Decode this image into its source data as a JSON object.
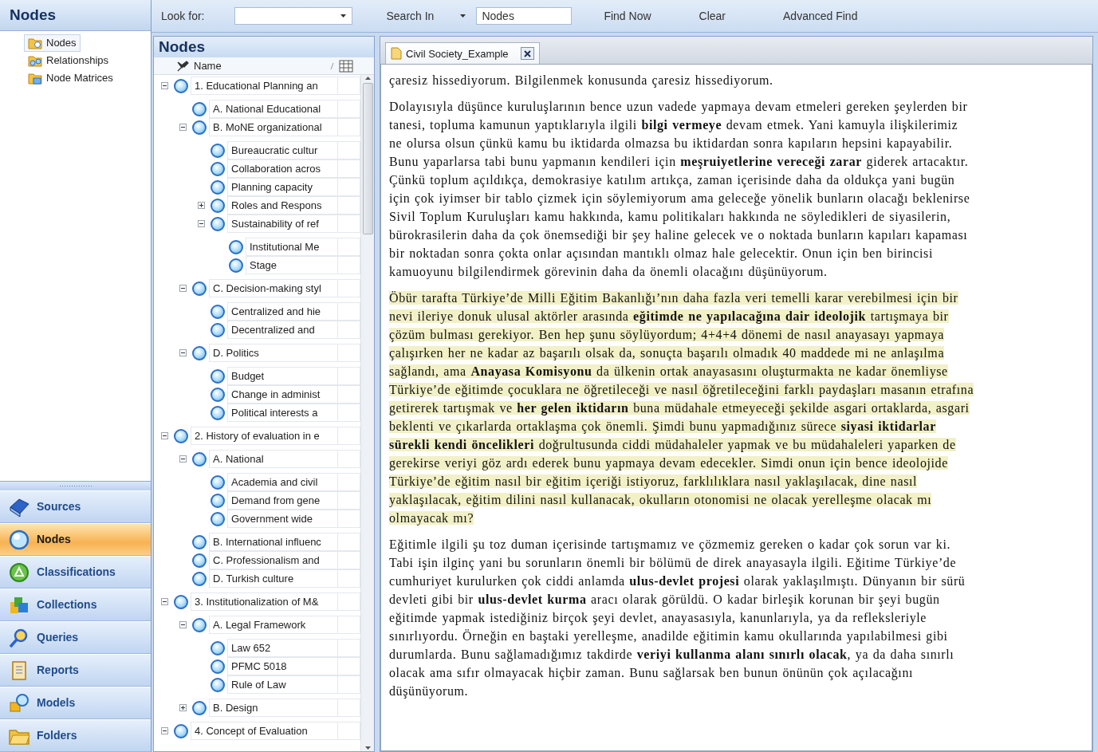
{
  "sidebar": {
    "title": "Nodes",
    "items": [
      {
        "label": "Nodes",
        "selected": true
      },
      {
        "label": "Relationships",
        "selected": false
      },
      {
        "label": "Node Matrices",
        "selected": false
      }
    ],
    "nav": [
      {
        "label": "Sources",
        "selected": false
      },
      {
        "label": "Nodes",
        "selected": true
      },
      {
        "label": "Classifications",
        "selected": false
      },
      {
        "label": "Collections",
        "selected": false
      },
      {
        "label": "Queries",
        "selected": false
      },
      {
        "label": "Reports",
        "selected": false
      },
      {
        "label": "Models",
        "selected": false
      },
      {
        "label": "Folders",
        "selected": false
      }
    ]
  },
  "find_bar": {
    "look_for_label": "Look for:",
    "search_in": "Search In",
    "scope": "Nodes",
    "buttons": [
      "Find Now",
      "Clear",
      "Advanced Find"
    ]
  },
  "nodes_panel": {
    "title": "Nodes",
    "column": "Name",
    "tree": [
      {
        "label": "1. Educational Planning an",
        "expanded": true,
        "children": [
          {
            "label": "A. National Educational"
          },
          {
            "label": "B. MoNE organizational",
            "expanded": true,
            "children": [
              {
                "label": "Bureaucratic cultur"
              },
              {
                "label": "Collaboration acros"
              },
              {
                "label": "Planning capacity"
              },
              {
                "label": "Roles and Respons",
                "expanded": false
              },
              {
                "label": "Sustainability of ref",
                "expanded": true,
                "children": [
                  {
                    "label": "Institutional Me"
                  },
                  {
                    "label": "Stage"
                  }
                ]
              }
            ]
          },
          {
            "label": "C. Decision-making styl",
            "expanded": true,
            "children": [
              {
                "label": "Centralized and hie"
              },
              {
                "label": "Decentralized and"
              }
            ]
          },
          {
            "label": "D. Politics",
            "expanded": true,
            "children": [
              {
                "label": "Budget"
              },
              {
                "label": "Change in administ"
              },
              {
                "label": "Political interests a"
              }
            ]
          }
        ]
      },
      {
        "label": "2. History of evaluation in e",
        "expanded": true,
        "children": [
          {
            "label": "A. National",
            "expanded": true,
            "children": [
              {
                "label": "Academia and civil"
              },
              {
                "label": "Demand from gene"
              },
              {
                "label": "Government wide"
              }
            ]
          },
          {
            "label": "B. International influenc"
          },
          {
            "label": "C. Professionalism and"
          },
          {
            "label": "D. Turkish culture"
          }
        ]
      },
      {
        "label": "3. Institutionalization of M&",
        "expanded": true,
        "children": [
          {
            "label": "A. Legal Framework",
            "expanded": true,
            "children": [
              {
                "label": "Law 652"
              },
              {
                "label": "PFMC 5018"
              },
              {
                "label": "Rule of Law"
              }
            ]
          },
          {
            "label": "B. Design",
            "expanded": false
          }
        ]
      },
      {
        "label": "4. Concept of Evaluation",
        "expanded": true
      }
    ]
  },
  "document": {
    "tabs": [
      {
        "label": "Civil Society_Example",
        "selected": true
      }
    ],
    "paragraphs": [
      {
        "text": "çaresiz hissediyorum. Bilgilenmek konusunda çaresiz hissediyorum.",
        "highlighted": false
      },
      {
        "text": "Dolayısıyla düşünce kuruluşlarının bence uzun vadede yapmaya devam etmeleri gereken şeylerden bir tanesi, topluma kamunun yaptıklarıyla ilgili **bilgi vermeye** devam etmek. Yani kamuyla ilişkilerimiz ne olursa olsun çünkü kamu bu iktidarda olmazsa bu iktidardan sonra kapıların hepsini kapayabilir. Bunu yaparlarsa tabi bunu yapmanın kendileri için **meşruiyetlerine vereceği zarar** giderek artacaktır. Çünkü toplum açıldıkça, demokrasiye katılım artıkça, zaman içerisinde daha da oldukça yani bugün için çok iyimser bir tablo çizmek için söylemiyorum ama geleceğe yönelik bunların olacağı beklenirse Sivil Toplum Kuruluşları kamu hakkında, kamu politikaları hakkında ne söyledikleri de siyasilerin, bürokrasilerin daha da çok önemsediği bir şey haline gelecek ve o noktada bunların kapıları kapaması bir noktadan sonra çokta onlar açısından mantıklı olmaz hale gelecektir. Onun için ben birincisi kamuoyunu bilgilendirmek görevinin daha da önemli olacağını düşünüyorum.",
        "highlighted": false
      },
      {
        "text": "Öbür tarafta Türkiye’de Milli Eğitim Bakanlığı’nın daha fazla veri temelli karar verebilmesi için bir nevi ileriye donuk ulusal aktörler arasında **eğitimde ne yapılacağına dair ideolojik** tartışmaya bir çözüm bulması gerekiyor. Ben hep şunu söylüyordum; 4+4+4 dönemi de nasıl anayasayı yapmaya çalışırken her ne kadar az başarılı olsak da, sonuçta başarılı olmadık 40 maddede mi ne anlaşılma sağlandı, ama **Anayasa Komisyonu** da ülkenin ortak anayasasını oluşturmakta ne kadar önemliyse Türkiye’de eğitimde çocuklara ne öğretileceği ve nasıl öğretileceğini farklı paydaşları masanın etrafına getirerek tartışmak ve **her gelen iktidarın** buna müdahale etmeyeceği şekilde asgari ortaklarda, asgari beklenti ve çıkarlarda ortaklaşma çok önemli. Şimdi bunu yapmadığınız sürece **siyasi iktidarlar sürekli kendi öncelikleri** doğrultusunda ciddi müdahaleler yapmak ve bu müdahaleleri yaparken de gerekirse veriyi göz ardı ederek bunu yapmaya devam edecekler. Simdi onun için bence ideolojide Türkiye’de eğitim nasıl bir eğitim içeriği istiyoruz, farklılıklara nasıl yaklaşılacak, dine nasıl yaklaşılacak, eğitim dilini nasıl kullanacak, okulların otonomisi ne olacak yerelleşme olacak mı olmayacak mı?",
        "highlighted": true
      },
      {
        "text": "Eğitimle ilgili şu toz duman içerisinde tartışmamız ve çözmemiz gereken o kadar çok sorun var ki. Tabi işin ilginç yani bu sorunların önemli bir bölümü de direk anayasayla ilgili. Eğitime Türkiye’de cumhuriyet kurulurken çok ciddi anlamda **ulus-devlet projesi** olarak yaklaşılmıştı. Dünyanın bir sürü devleti gibi bir **ulus-devlet kurma** aracı olarak görüldü. O kadar birleşik korunan bir şeyi bugün eğitimde yapmak istediğiniz birçok şeyi devlet, anayasasıyla, kanunlarıyla, ya da refleksleriyle sınırlıyordu. Örneğin en baştaki yerelleşme, anadilde eğitimin kamu okullarında yapılabilmesi gibi durumlarda. Bunu sağlamadığımız takdirde **veriyi kullanma alanı sınırlı olacak**, ya da daha sınırlı olacak ama sıfır olmayacak hiçbir zaman. Bunu sağlarsak ben bunun önünün çok açılacağını düşünüyorum.",
        "highlighted": false
      }
    ]
  }
}
